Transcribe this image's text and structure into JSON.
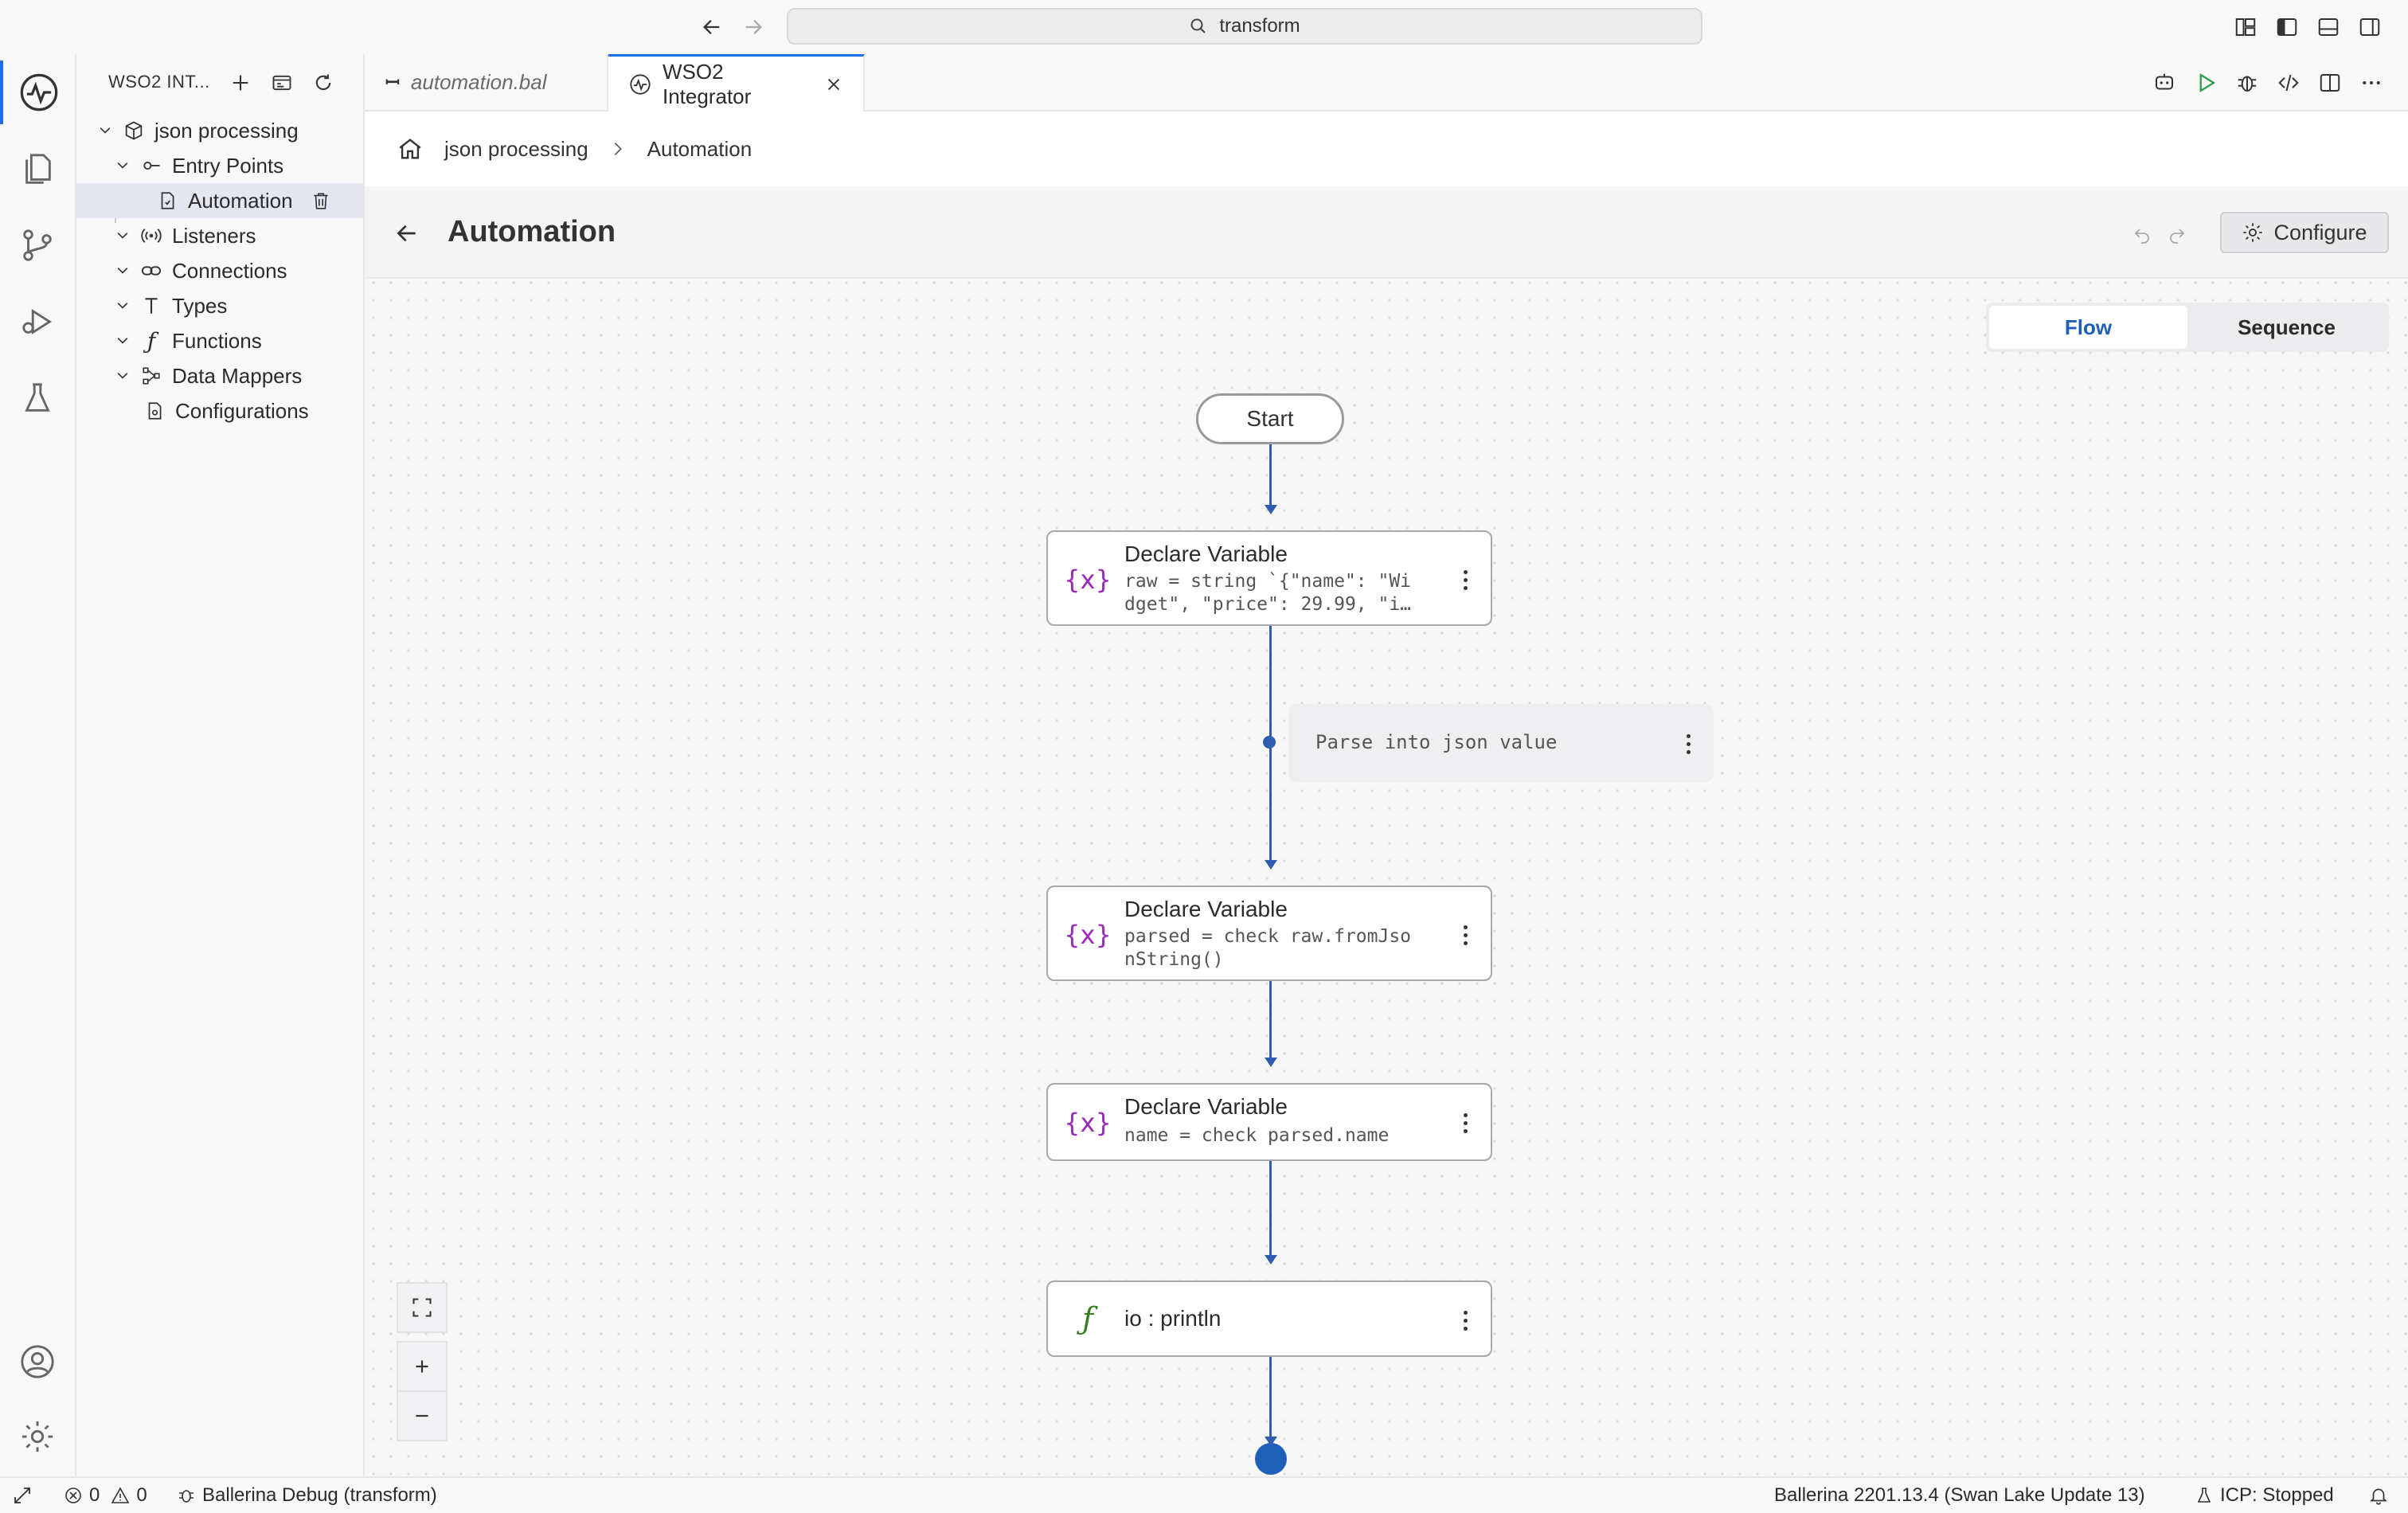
{
  "titlebar": {
    "search_text": "transform",
    "icons": [
      "arrow-left-icon",
      "arrow-right-icon",
      "search-icon",
      "customize-layout-icon",
      "toggle-primary-sidebar-icon",
      "toggle-panel-icon",
      "toggle-secondary-sidebar-icon"
    ]
  },
  "activity_bar": {
    "items": [
      "wso2-integrator-icon",
      "explorer-icon",
      "source-control-icon",
      "run-debug-icon",
      "testing-icon"
    ],
    "bottom": [
      "account-icon",
      "manage-gear-icon"
    ],
    "accent_color": "#1f6feb"
  },
  "sidebar": {
    "title": "WSO2 INT...",
    "tree": [
      {
        "label": "json processing",
        "icon": "package-icon",
        "level": 0
      },
      {
        "label": "Entry Points",
        "icon": "entry-point-icon",
        "level": 1
      },
      {
        "label": "Automation",
        "icon": "file-code-icon",
        "level": 2,
        "selected": true
      },
      {
        "label": "Listeners",
        "icon": "broadcast-icon",
        "level": 1
      },
      {
        "label": "Connections",
        "icon": "link-icon",
        "level": 1
      },
      {
        "label": "Types",
        "icon": "type-icon",
        "level": 1
      },
      {
        "label": "Functions",
        "icon": "function-icon",
        "level": 1
      },
      {
        "label": "Data Mappers",
        "icon": "data-mapper-icon",
        "level": 1
      },
      {
        "label": "Configurations",
        "icon": "config-file-icon",
        "level": 1
      }
    ]
  },
  "tabs": [
    {
      "label": "automation.bal",
      "active": false
    },
    {
      "label": "WSO2 Integrator",
      "active": true
    }
  ],
  "breadcrumb": {
    "project": "json processing",
    "current": "Automation"
  },
  "page": {
    "title": "Automation",
    "configure_label": "Configure"
  },
  "view_toggle": {
    "options": [
      "Flow",
      "Sequence"
    ],
    "selected": "Flow"
  },
  "flow": {
    "start_label": "Start",
    "nodes": [
      {
        "title": "Declare Variable",
        "code": "raw = string `{\"name\": \"Wi\ndget\", \"price\": 29.99, \"i…",
        "icon": "variable-icon"
      },
      {
        "title": "Declare Variable",
        "code": "parsed = check raw.fromJso\nnString()",
        "icon": "variable-icon"
      },
      {
        "title": "Declare Variable",
        "code": "name = check parsed.name",
        "icon": "variable-icon"
      },
      {
        "title": "io : println",
        "code": "",
        "icon": "function-icon"
      }
    ],
    "comment": "Parse into json value",
    "edge_color": "#2f5eb0",
    "variable_icon_color": "#9b2bb8",
    "function_icon_color": "#3a7d1e"
  },
  "zoom_controls": [
    "fit-screen-icon",
    "zoom-in-icon",
    "zoom-out-icon"
  ],
  "statusbar": {
    "errors": "0",
    "warnings": "0",
    "debug_label": "Ballerina Debug (transform)",
    "version": "Ballerina 2201.13.4 (Swan Lake Update 13)",
    "icp": "ICP: Stopped"
  }
}
